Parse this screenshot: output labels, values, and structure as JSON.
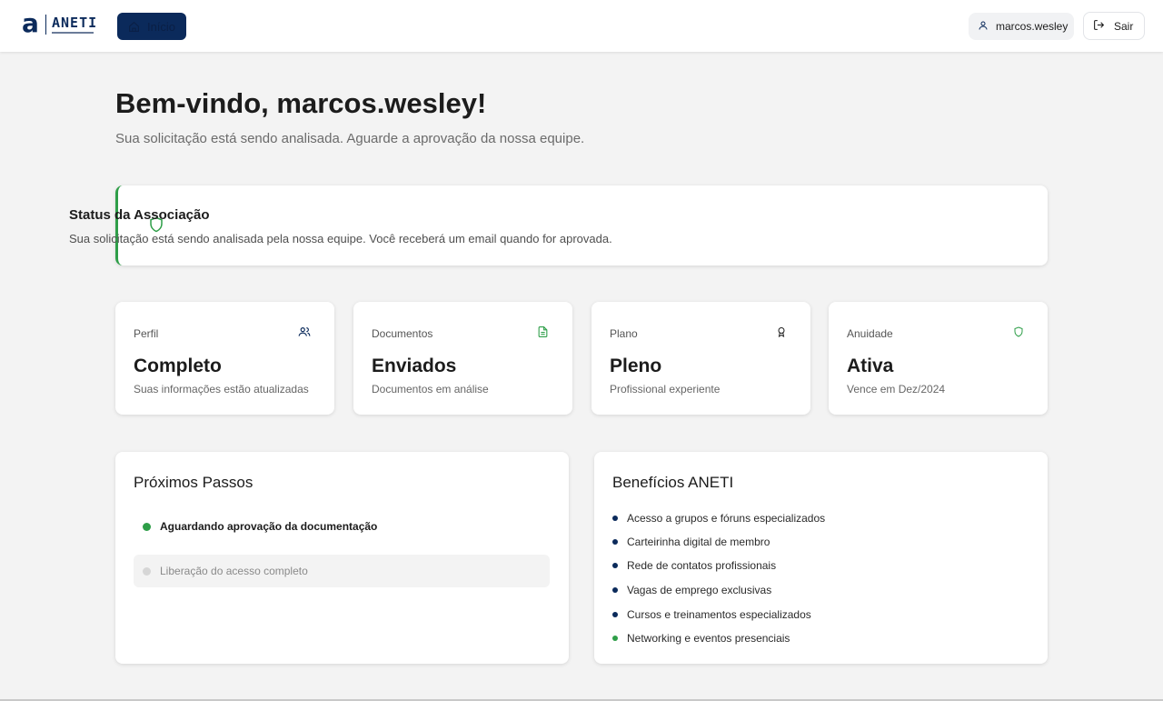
{
  "header": {
    "brand_letter": "a",
    "brand_name": "ANETI",
    "home_label": "Início",
    "username": "marcos.wesley",
    "logout_label": "Sair"
  },
  "welcome": {
    "title": "Bem-vindo, marcos.wesley!",
    "subtitle": "Sua solicitação está sendo analisada. Aguarde a aprovação da nossa equipe."
  },
  "status": {
    "title": "Status da Associação",
    "text": "Sua solicitação está sendo analisada pela nossa equipe. Você receberá um email quando for aprovada.",
    "accent_color": "#2e9e48"
  },
  "stats": [
    {
      "label": "Perfil",
      "value": "Completo",
      "desc": "Suas informações estão atualizadas",
      "icon": "users-icon",
      "icon_color": "#0b2a5b"
    },
    {
      "label": "Documentos",
      "value": "Enviados",
      "desc": "Documentos em análise",
      "icon": "document-icon",
      "icon_color": "#2e9e48"
    },
    {
      "label": "Plano",
      "value": "Pleno",
      "desc": "Profissional experiente",
      "icon": "award-icon",
      "icon_color": "#1c1c1c"
    },
    {
      "label": "Anuidade",
      "value": "Ativa",
      "desc": "Vence em Dez/2024",
      "icon": "shield-icon",
      "icon_color": "#2e9e48"
    }
  ],
  "next_steps": {
    "title": "Próximos Passos",
    "items": [
      {
        "label": "Aguardando aprovação da documentação",
        "state": "done"
      },
      {
        "label": "Liberação do acesso completo",
        "state": "pending"
      }
    ]
  },
  "benefits": {
    "title": "Benefícios ANETI",
    "items": [
      {
        "label": "Acesso a grupos e fóruns especializados",
        "color": "#0b2a5b"
      },
      {
        "label": "Carteirinha digital de membro",
        "color": "#0b2a5b"
      },
      {
        "label": "Rede de contatos profissionais",
        "color": "#0b2a5b"
      },
      {
        "label": "Vagas de emprego exclusivas",
        "color": "#0b2a5b"
      },
      {
        "label": "Cursos e treinamentos especializados",
        "color": "#0b2a5b"
      },
      {
        "label": "Networking e eventos presenciais",
        "color": "#2e9e48"
      }
    ]
  },
  "colors": {
    "brand": "#0b2a5b",
    "success": "#2e9e48",
    "background": "#f3f3f3"
  }
}
